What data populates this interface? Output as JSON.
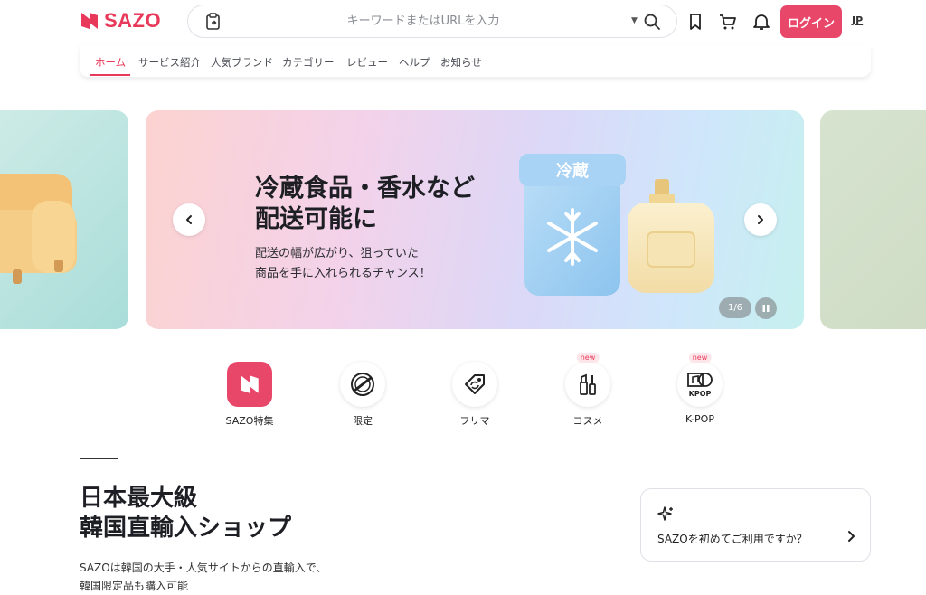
{
  "header": {
    "logo_text": "SAZO",
    "search_placeholder": "キーワードまたはURLを入力",
    "login_label": "ログイン",
    "lang_label": "JP",
    "brand_color": "#e8395a"
  },
  "nav": {
    "items": [
      {
        "label": "ホーム",
        "active": true
      },
      {
        "label": "サービス紹介"
      },
      {
        "label": "人気ブランド"
      },
      {
        "label": "カテゴリー"
      },
      {
        "label": "レビュー"
      },
      {
        "label": "ヘルプ"
      },
      {
        "label": "お知らせ"
      }
    ]
  },
  "banner": {
    "title_line1": "冷蔵食品・香水など",
    "title_line2": "配送可能に",
    "sub_line1": "配送の幅が広がり、狙っていた",
    "sub_line2": "商品を手に入れられるチャンス！",
    "fridge_label": "冷蔵",
    "counter": "1/6"
  },
  "categories": [
    {
      "label": "SAZO特集",
      "icon": "sazo-logo-icon"
    },
    {
      "label": "限定",
      "icon": "limited-stamp-icon"
    },
    {
      "label": "フリマ",
      "icon": "price-tag-icon"
    },
    {
      "label": "コスメ",
      "icon": "cosmetics-icon",
      "badge": "new"
    },
    {
      "label": "K-POP",
      "icon": "kpop-album-icon",
      "badge": "new",
      "icon_text": "KPOP"
    }
  ],
  "hero": {
    "title_line1": "日本最大級",
    "title_line2": "韓国直輸入ショップ",
    "desc_line1": "SAZOは韓国の大手・人気サイトからの直輸入で、",
    "desc_line2": "韓国限定品も購入可能"
  },
  "first_time": {
    "label": "SAZOを初めてご利用ですか？"
  }
}
